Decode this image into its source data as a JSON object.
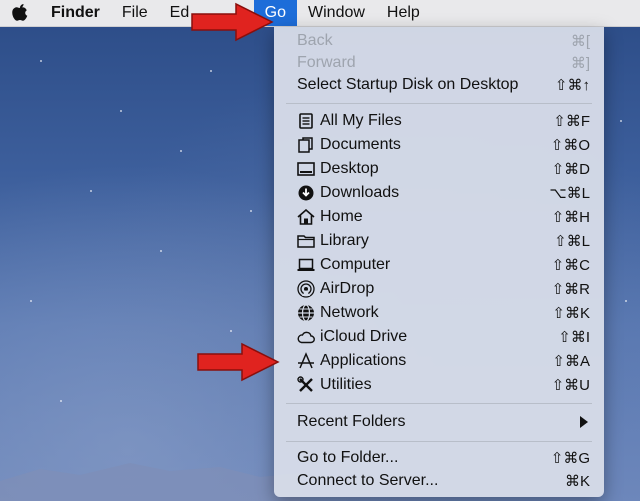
{
  "menubar": {
    "app_name": "Finder",
    "items": [
      {
        "label": "File"
      },
      {
        "label": "Ed"
      },
      {
        "label": "Go"
      },
      {
        "label": "Window"
      },
      {
        "label": "Help"
      }
    ]
  },
  "go_menu": {
    "section1": [
      {
        "label": "Back",
        "shortcut": "⌘[",
        "disabled": true
      },
      {
        "label": "Forward",
        "shortcut": "⌘]",
        "disabled": true
      },
      {
        "label": "Select Startup Disk on Desktop",
        "shortcut": "⇧⌘↑",
        "disabled": false
      }
    ],
    "section2": [
      {
        "label": "All My Files",
        "shortcut": "⇧⌘F",
        "icon": "all-my-files-icon"
      },
      {
        "label": "Documents",
        "shortcut": "⇧⌘O",
        "icon": "documents-icon"
      },
      {
        "label": "Desktop",
        "shortcut": "⇧⌘D",
        "icon": "desktop-icon"
      },
      {
        "label": "Downloads",
        "shortcut": "⌥⌘L",
        "icon": "downloads-icon"
      },
      {
        "label": "Home",
        "shortcut": "⇧⌘H",
        "icon": "home-icon"
      },
      {
        "label": "Library",
        "shortcut": "⇧⌘L",
        "icon": "folder-icon"
      },
      {
        "label": "Computer",
        "shortcut": "⇧⌘C",
        "icon": "computer-icon"
      },
      {
        "label": "AirDrop",
        "shortcut": "⇧⌘R",
        "icon": "airdrop-icon"
      },
      {
        "label": "Network",
        "shortcut": "⇧⌘K",
        "icon": "network-icon"
      },
      {
        "label": "iCloud Drive",
        "shortcut": "⇧⌘I",
        "icon": "icloud-icon"
      },
      {
        "label": "Applications",
        "shortcut": "⇧⌘A",
        "icon": "applications-icon"
      },
      {
        "label": "Utilities",
        "shortcut": "⇧⌘U",
        "icon": "utilities-icon"
      }
    ],
    "section3": [
      {
        "label": "Recent Folders"
      }
    ],
    "section4": [
      {
        "label": "Go to Folder...",
        "shortcut": "⇧⌘G"
      },
      {
        "label": "Connect to Server...",
        "shortcut": "⌘K"
      }
    ]
  },
  "colors": {
    "menubar_bg": "#e9e9eb",
    "active_menu": "#1d6dd9",
    "dropdown_bg": "#d6dce8",
    "arrow_red": "#e0231f"
  }
}
